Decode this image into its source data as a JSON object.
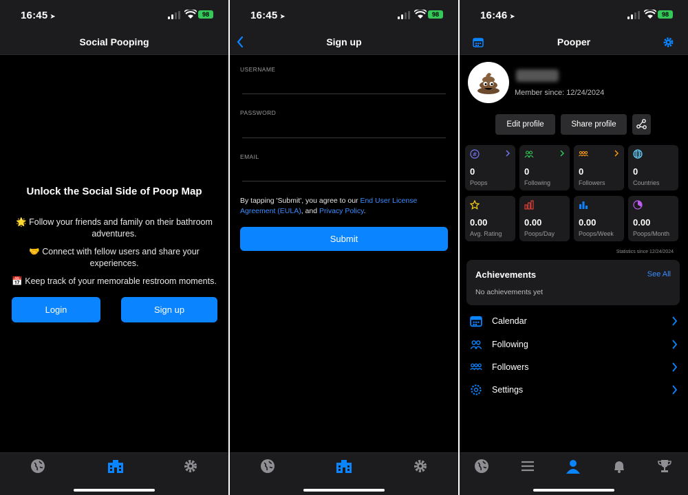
{
  "screen1": {
    "status_time": "16:45",
    "battery": "98",
    "nav_title": "Social Pooping",
    "heading": "Unlock the Social Side of Poop Map",
    "features": [
      {
        "emoji": "🌟",
        "text1": "Follow your friends and family on their bathroom",
        "text2": "adventures."
      },
      {
        "emoji": "🤝",
        "text1": "Connect with fellow users and share your",
        "text2": "experiences."
      },
      {
        "emoji": "📅",
        "text1": "Keep track of your memorable restroom moments.",
        "text2": ""
      }
    ],
    "login_label": "Login",
    "signup_label": "Sign up"
  },
  "screen2": {
    "status_time": "16:45",
    "battery": "98",
    "nav_title": "Sign up",
    "username_label": "USERNAME",
    "password_label": "PASSWORD",
    "email_label": "EMAIL",
    "terms_pre": "By tapping 'Submit', you agree to our ",
    "terms_eula": "End User License Agreement (EULA)",
    "terms_mid": ", and ",
    "terms_privacy": "Privacy Policy",
    "terms_end": ".",
    "submit_label": "Submit"
  },
  "screen3": {
    "status_time": "16:46",
    "battery": "98",
    "nav_title": "Pooper",
    "member_since": "Member since: 12/24/2024",
    "edit_profile": "Edit profile",
    "share_profile": "Share profile",
    "stats": [
      {
        "value": "0",
        "label": "Poops",
        "color": "#7b7bff"
      },
      {
        "value": "0",
        "label": "Following",
        "color": "#30d158"
      },
      {
        "value": "0",
        "label": "Followers",
        "color": "#ff9f0a"
      },
      {
        "value": "0",
        "label": "Countries",
        "color": "#64d2ff"
      },
      {
        "value": "0.00",
        "label": "Avg. Rating",
        "color": "#ffd60a"
      },
      {
        "value": "0.00",
        "label": "Poops/Day",
        "color": "#ff453a"
      },
      {
        "value": "0.00",
        "label": "Poops/Week",
        "color": "#0a84ff"
      },
      {
        "value": "0.00",
        "label": "Poops/Month",
        "color": "#bf5af2"
      }
    ],
    "stats_note": "Statistics since 12/24/2024",
    "achievements_title": "Achievements",
    "see_all": "See All",
    "no_achievements": "No achievements yet",
    "menu": [
      {
        "label": "Calendar"
      },
      {
        "label": "Following"
      },
      {
        "label": "Followers"
      },
      {
        "label": "Settings"
      }
    ]
  },
  "accent_color": "#0a84ff"
}
